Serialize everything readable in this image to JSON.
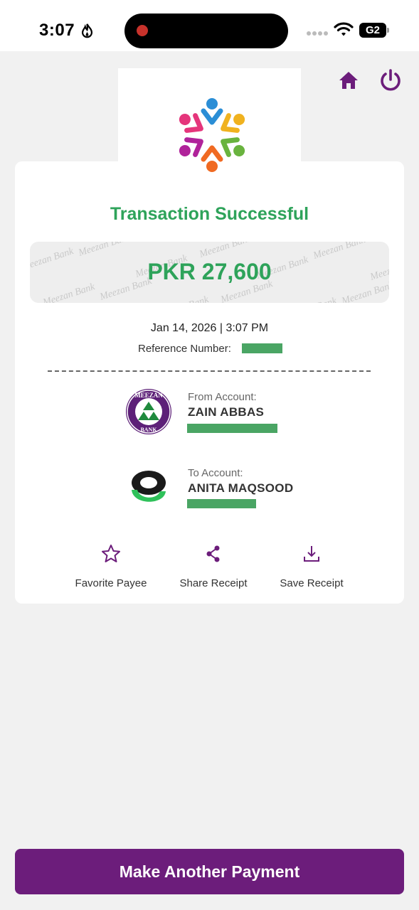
{
  "status_bar": {
    "time": "3:07",
    "network": "G2"
  },
  "header": {
    "home_icon": "home-icon",
    "power_icon": "power-icon"
  },
  "receipt": {
    "status_title": "Transaction Successful",
    "amount": "PKR 27,600",
    "watermark_text": "Meezan Bank",
    "datetime": "Jan 14, 2026 | 3:07 PM",
    "reference_label": "Reference Number:",
    "from": {
      "label": "From Account:",
      "name": "ZAIN ABBAS"
    },
    "to": {
      "label": "To Account:",
      "name": "ANITA MAQSOOD"
    },
    "actions": [
      {
        "label": "Favorite Payee",
        "icon": "star-icon"
      },
      {
        "label": "Share Receipt",
        "icon": "share-icon"
      },
      {
        "label": "Save Receipt",
        "icon": "download-icon"
      }
    ]
  },
  "footer": {
    "cta_label": "Make Another Payment"
  },
  "colors": {
    "brand_purple": "#6c1d7b",
    "success_green": "#2ea35a",
    "redaction_green": "#4aa564"
  }
}
